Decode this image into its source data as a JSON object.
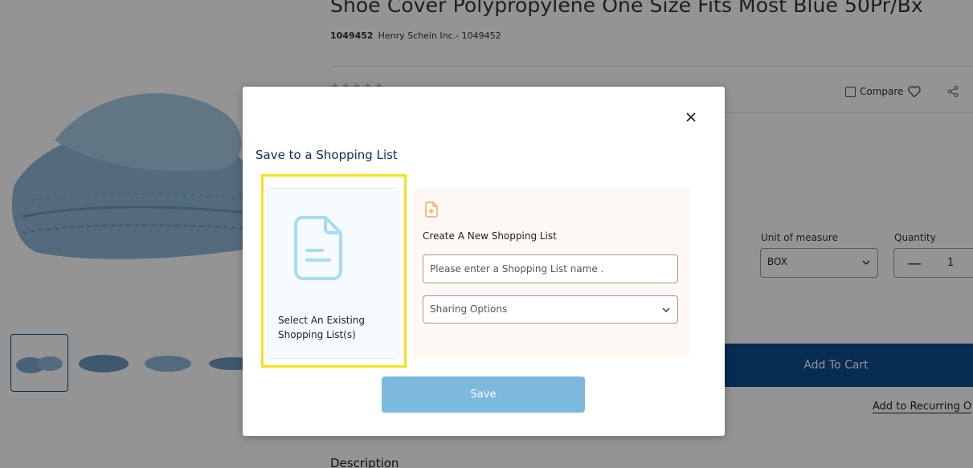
{
  "product": {
    "title": "Shoe Cover Polypropylene One Size Fits Most Blue 50Pr/Bx",
    "item_number": "1049452",
    "manufacturer": "Henry Schein Inc.- 1049452",
    "rating_stars": "★★★★★",
    "compare_label": "Compare",
    "unit_of_measure_label": "Unit of measure",
    "unit_of_measure_value": "BOX",
    "quantity_label": "Quantity",
    "quantity_minus": "—",
    "quantity_value": "1",
    "add_to_cart_label": "Add To Cart",
    "add_to_recurring_label": "Add to Recurring O",
    "description_heading": "Description"
  },
  "modal": {
    "title": "Save to a Shopping List",
    "existing_list_label": "Select An Existing Shopping List(s)",
    "create_new_label": "Create A New Shopping List",
    "name_input_placeholder": "Please enter a Shopping List name .",
    "name_input_value": "",
    "sharing_options_label": "Sharing Options",
    "save_label": "Save"
  },
  "colors": {
    "brand_blue": "#0b4c8c",
    "save_button": "#7db8dd",
    "highlight": "#f7e11b",
    "title_navy": "#0b2d5c"
  },
  "icons": {
    "close": "close-icon",
    "document": "document-icon",
    "add_document": "add-document-icon",
    "heart": "heart-icon",
    "share": "share-icon",
    "chevron": "chevron-down-icon"
  }
}
